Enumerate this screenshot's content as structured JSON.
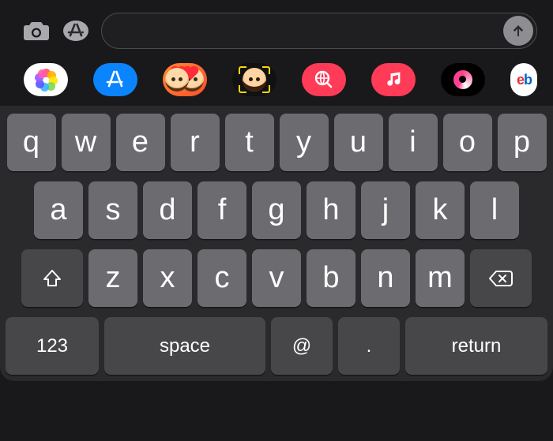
{
  "toolbar": {
    "camera_icon": "camera",
    "appstore_icon": "app-store",
    "input_value": "",
    "send_icon": "arrow-up"
  },
  "app_strip": [
    {
      "id": "photos",
      "name": "Photos"
    },
    {
      "id": "app-store",
      "name": "App Store"
    },
    {
      "id": "memoji",
      "name": "Memoji Stickers"
    },
    {
      "id": "animoji",
      "name": "Animoji"
    },
    {
      "id": "search",
      "name": "#images"
    },
    {
      "id": "music",
      "name": "Apple Music"
    },
    {
      "id": "stickers",
      "name": "Stickers"
    },
    {
      "id": "ebay",
      "name": "eBay",
      "short": "eb"
    }
  ],
  "keyboard": {
    "row1": [
      "q",
      "w",
      "e",
      "r",
      "t",
      "y",
      "u",
      "i",
      "o",
      "p"
    ],
    "row2": [
      "a",
      "s",
      "d",
      "f",
      "g",
      "h",
      "j",
      "k",
      "l"
    ],
    "row3": [
      "z",
      "x",
      "c",
      "v",
      "b",
      "n",
      "m"
    ],
    "fn": {
      "shift": "shift",
      "backspace": "delete",
      "numbers": "123",
      "space": "space",
      "at": "@",
      "period": ".",
      "return": "return"
    }
  }
}
